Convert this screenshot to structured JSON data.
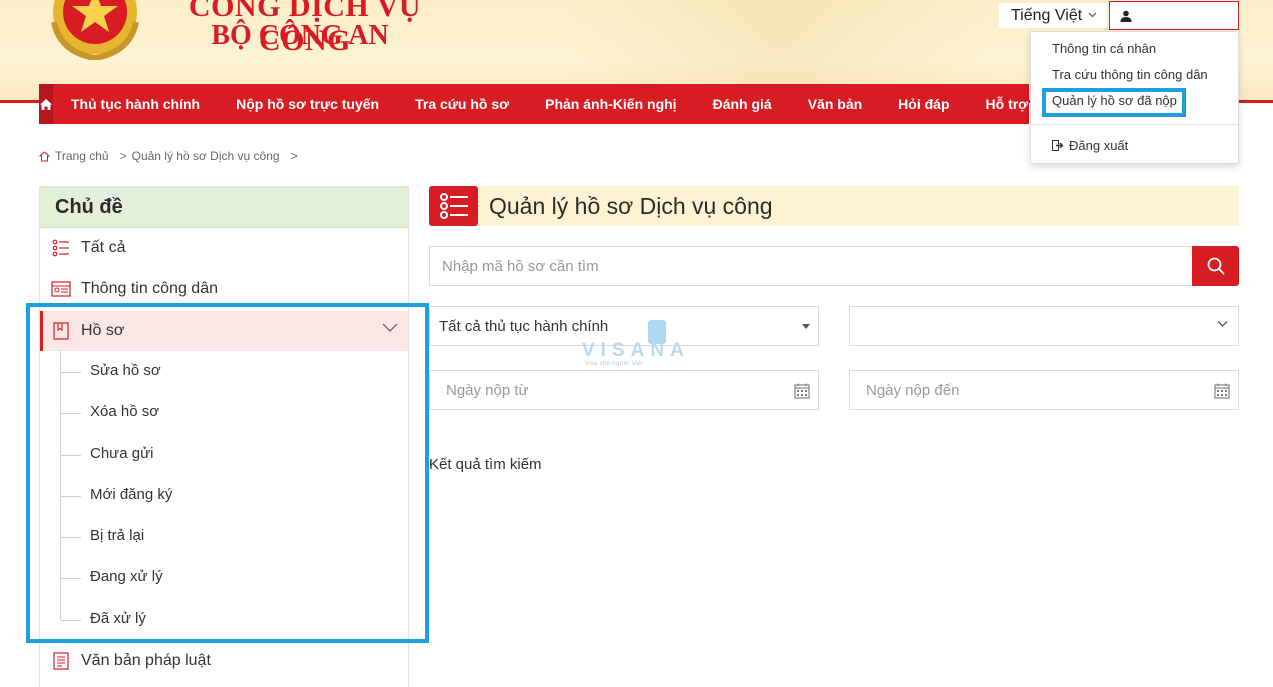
{
  "header": {
    "brand_line1": "CỔNG DỊCH VỤ CÔNG",
    "brand_line2": "BỘ CÔNG AN",
    "language": "Tiếng Việt"
  },
  "nav": {
    "items": [
      "Thủ tục hành chính",
      "Nộp hồ sơ trực tuyến",
      "Tra cứu hồ sơ",
      "Phản ánh-Kiến nghị",
      "Đánh giá",
      "Văn bản",
      "Hỏi đáp",
      "Hỗ trợ"
    ]
  },
  "user_menu": {
    "items": [
      "Thông tin cá nhân",
      "Tra cứu thông tin công dân",
      "Quản lý hồ sơ đã nộp"
    ],
    "logout": "Đăng xuất"
  },
  "breadcrumb": {
    "home": "Trang chủ",
    "separator": ">",
    "current": "Quản lý hồ sơ Dịch vụ công"
  },
  "sidebar": {
    "heading": "Chủ đề",
    "items": [
      "Tất cả",
      "Thông tin công dân",
      "Hồ sơ"
    ],
    "sub_items": [
      "Sửa hồ sơ",
      "Xóa hồ sơ",
      "Chưa gửi",
      "Mới đăng ký",
      "Bị trả lại",
      "Đang xử lý",
      "Đã xử lý"
    ],
    "bottom_item": "Văn bản pháp luật"
  },
  "main": {
    "title": "Quản lý hồ sơ Dịch vụ công",
    "search_placeholder": "Nhập mã hồ sơ cần tìm",
    "procedure_select": "Tất cả thủ tục hành chính",
    "date_from_placeholder": "Ngày nộp từ",
    "date_to_placeholder": "Ngày nộp đến",
    "results_label": "Kết quả tìm kiếm"
  },
  "watermark": {
    "brand": "VISANA",
    "tagline": "Visa cho người Việt"
  },
  "colors": {
    "primary_red": "#d81c24",
    "highlight_blue": "#1e9fe0",
    "sidebar_header_bg": "#e3f0d9",
    "title_bar_bg": "#fdf3d4"
  }
}
